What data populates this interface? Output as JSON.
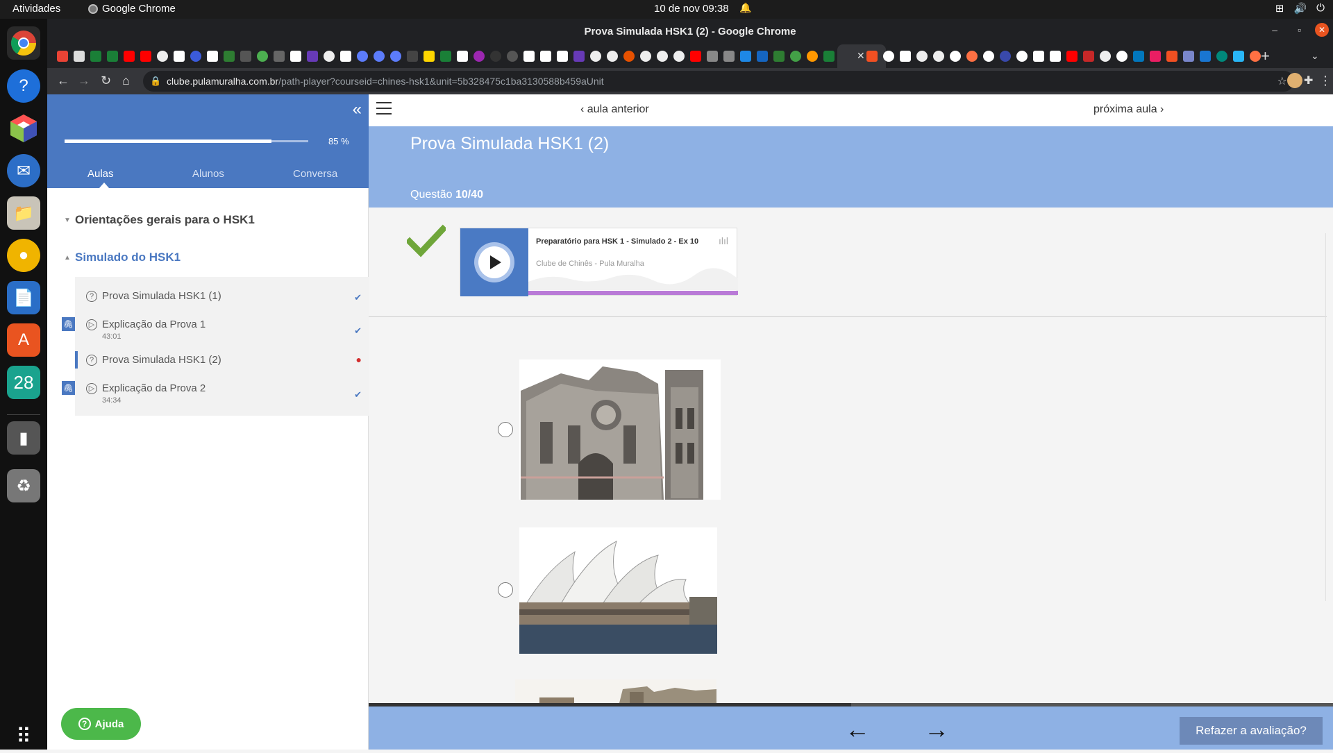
{
  "system": {
    "activities": "Atividades",
    "app_name": "Google Chrome",
    "clock": "10 de nov  09:38"
  },
  "dock": {
    "calendar_day": "28"
  },
  "browser": {
    "window_title": "Prova Simulada HSK1 (2) - Google Chrome",
    "url_domain": "clube.pulamuralha.com.br",
    "url_path": "/path-player?courseid=chines-hsk1&unit=5b328475c1ba3130588b459aUnit"
  },
  "sidebar": {
    "progress_text": "85 %",
    "progress_fraction": 0.85,
    "tabs": [
      {
        "label": "Aulas"
      },
      {
        "label": "Alunos"
      },
      {
        "label": "Conversa"
      }
    ],
    "sections": [
      {
        "title": "Orientações gerais para o HSK1"
      },
      {
        "title": "Simulado do HSK1"
      }
    ],
    "lessons": [
      {
        "label": "Prova Simulada HSK1 (1)",
        "duration": "",
        "status": "done"
      },
      {
        "label": "Explicação da Prova 1",
        "duration": "43:01",
        "status": "done"
      },
      {
        "label": "Prova Simulada HSK1 (2)",
        "duration": "",
        "status": "current"
      },
      {
        "label": "Explicação da Prova 2",
        "duration": "34:34",
        "status": "done"
      }
    ],
    "help_label": "Ajuda"
  },
  "main": {
    "prev_label": "aula anterior",
    "next_label": "próxima aula",
    "title": "Prova Simulada HSK1 (2)",
    "question_prefix": "Questão",
    "question_number": "10/40",
    "player": {
      "track_title": "Preparatório para HSK 1 - Simulado 2 - Ex 10",
      "artist": "Clube de Chinês - Pula Muralha"
    },
    "retry_label": "Refazer a avaliação?",
    "colors": {
      "sidebar_header": "#4a78c1",
      "main_header": "#8eb1e4",
      "help_button": "#4cb84a",
      "check": "#6fa63a"
    }
  }
}
